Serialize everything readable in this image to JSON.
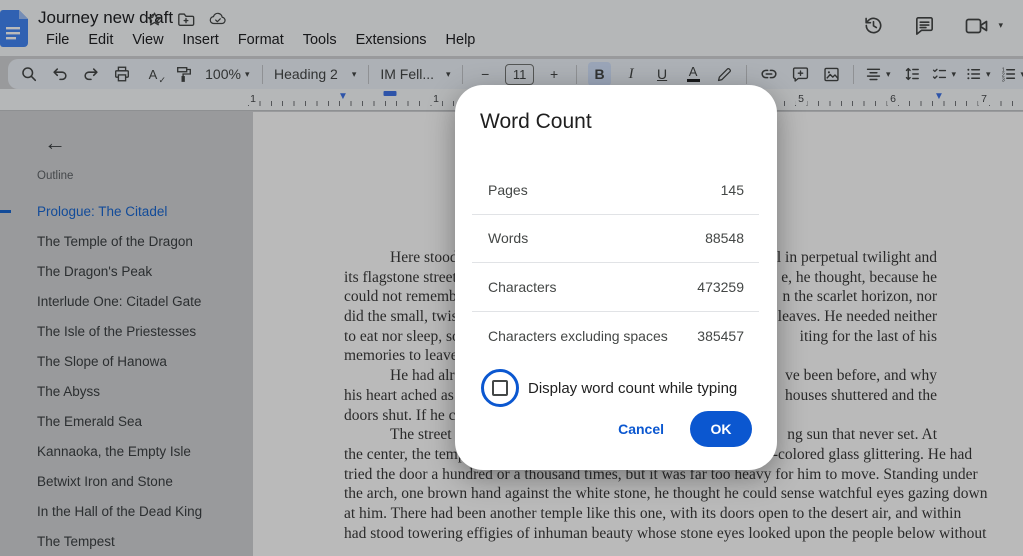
{
  "header": {
    "title": "Journey new draft",
    "menus": [
      {
        "label": "File"
      },
      {
        "label": "Edit"
      },
      {
        "label": "View"
      },
      {
        "label": "Insert"
      },
      {
        "label": "Format"
      },
      {
        "label": "Tools"
      },
      {
        "label": "Extensions"
      },
      {
        "label": "Help"
      }
    ]
  },
  "toolbar": {
    "zoom_value": "100%",
    "style_value": "Heading 2",
    "font_value": "IM Fell...",
    "font_size_value": "11",
    "bold_label": "B",
    "italic_label": "I",
    "underline_label": "U",
    "text_color_label": "A",
    "spellcheck_label": "A",
    "minus_label": "−",
    "plus_label": "+"
  },
  "ruler": {
    "numbers": [
      {
        "label": "1"
      },
      {
        "label": "1"
      },
      {
        "label": "5"
      },
      {
        "label": "6"
      },
      {
        "label": "7"
      }
    ]
  },
  "sidebar": {
    "back_icon": "←",
    "outline_label": "Outline",
    "items": [
      {
        "label": "Prologue: The Citadel",
        "active": true
      },
      {
        "label": "The Temple of the Dragon"
      },
      {
        "label": "The Dragon's Peak"
      },
      {
        "label": "Interlude One: Citadel Gate"
      },
      {
        "label": "The Isle of the Priestesses"
      },
      {
        "label": "The Slope of Hanowa"
      },
      {
        "label": "The Abyss"
      },
      {
        "label": "The Emerald Sea"
      },
      {
        "label": "Kannaoka, the Empty Isle"
      },
      {
        "label": "Betwixt Iron and Stone"
      },
      {
        "label": "In the Hall of the Dead King"
      },
      {
        "label": "The Tempest"
      }
    ]
  },
  "document": {
    "lines": [
      {
        "left": "Here stood",
        "right": "l in perpetual twilight and",
        "full": "",
        "indent": true
      },
      {
        "left": "its flagstone streets",
        "right": "e, he thought, because he",
        "full": ""
      },
      {
        "left": "could not remembe",
        "right": "n the scarlet horizon, nor",
        "full": ""
      },
      {
        "left": "did the small, twist",
        "right": "r leaves. He needed neither",
        "full": ""
      },
      {
        "left": "to eat nor sleep, so",
        "right": "iting for the last of his",
        "full": ""
      },
      {
        "left": "memories to leave",
        "right": "",
        "full": ""
      },
      {
        "left": "He had alr",
        "right": "ve been before, and why",
        "full": "",
        "indent": true
      },
      {
        "left": "his heart ached as h",
        "right": "houses shuttered and the",
        "full": ""
      },
      {
        "left": "doors shut. If he co",
        "right": "",
        "full": ""
      },
      {
        "left": "The street",
        "right": "ng sun that never set. At",
        "full": "",
        "indent": true
      },
      {
        "left": "",
        "right": "",
        "full": "the center, the temple stood watch over the city, its windows of many-colored glass glittering. He had"
      },
      {
        "left": "",
        "right": "",
        "full": "tried the door a hundred or a thousand times, but it was far too heavy for him to move. Standing under"
      },
      {
        "left": "",
        "right": "",
        "full": "the arch, one brown hand against the white stone, he thought he could sense watchful eyes gazing down"
      },
      {
        "left": "",
        "right": "",
        "full": "at him. There had been another temple like this one, with its doors open to the desert air, and within"
      },
      {
        "left": "",
        "right": "",
        "full": "had stood towering effigies of inhuman beauty whose stone eyes looked upon the people below without"
      }
    ]
  },
  "dialog": {
    "title": "Word Count",
    "rows": [
      {
        "label": "Pages",
        "value": "145"
      },
      {
        "label": "Words",
        "value": "88548"
      },
      {
        "label": "Characters",
        "value": "473259"
      },
      {
        "label": "Characters excluding spaces",
        "value": "385457"
      }
    ],
    "checkbox_label": "Display word count while typing",
    "checkbox_checked": false,
    "cancel_label": "Cancel",
    "ok_label": "OK"
  },
  "colors": {
    "accent": "#0b57d0",
    "docs_blue": "#4285f4",
    "active_outline": "#1967d2",
    "bold_active_bg": "#d3e3fd"
  }
}
